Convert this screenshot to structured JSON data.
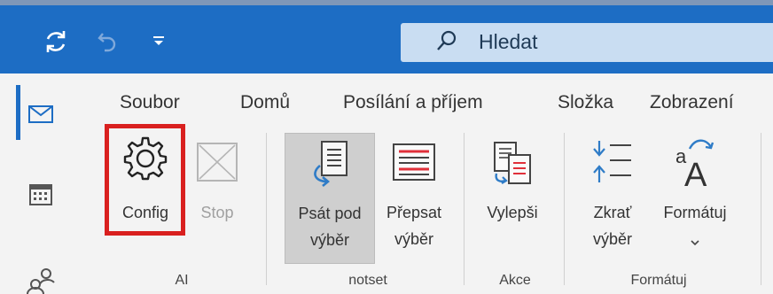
{
  "titlebar": {
    "sync_icon": "sync-icon",
    "undo_icon": "undo-icon",
    "quick_access_icon": "chevron-down-icon",
    "search": {
      "icon": "search-icon",
      "placeholder": "Hledat"
    }
  },
  "rail": {
    "items": [
      {
        "name": "mail",
        "icon": "mail-icon"
      },
      {
        "name": "calendar",
        "icon": "calendar-icon"
      },
      {
        "name": "people",
        "icon": "people-icon"
      }
    ]
  },
  "tabs": [
    "Soubor",
    "Domů",
    "Posílání a příjem",
    "Složka",
    "Zobrazení"
  ],
  "ribbon": {
    "groups": {
      "ai": {
        "label": "AI",
        "config": {
          "label": "Config",
          "icon": "gear-icon"
        },
        "stop": {
          "label": "Stop",
          "icon": "close-icon"
        }
      },
      "notset": {
        "label": "notset",
        "write_under": {
          "label1": "Psát pod",
          "label2": "výběr",
          "icon": "document-arrow-icon"
        },
        "rewrite": {
          "label1": "Přepsat",
          "label2": "výběr",
          "icon": "document-lines-icon"
        }
      },
      "akce": {
        "label": "Akce",
        "improve": {
          "label": "Vylepši",
          "icon": "documents-swap-icon"
        }
      },
      "format": {
        "label": "Formátuj",
        "shorten": {
          "label1": "Zkrať",
          "label2": "výběr",
          "icon": "shorten-icon"
        },
        "format_btn": {
          "label": "Formátuj",
          "icon": "font-size-icon"
        }
      }
    }
  },
  "colors": {
    "titlebar": "#1d6dc4",
    "highlight": "#d9201f",
    "accent_red": "#e0303a"
  }
}
